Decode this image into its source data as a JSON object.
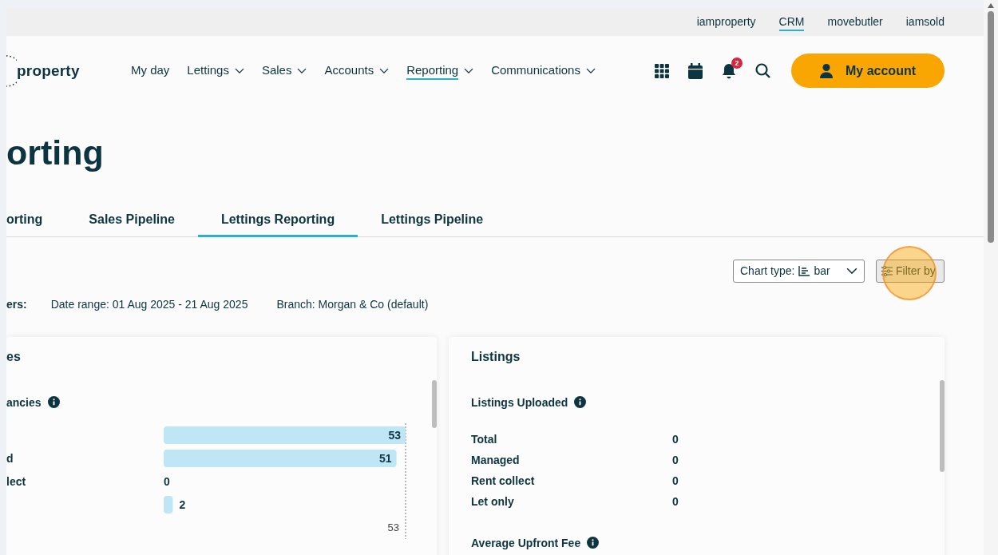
{
  "top_links": [
    {
      "label": "iamproperty",
      "selected": false
    },
    {
      "label": "CRM",
      "selected": true
    },
    {
      "label": "movebutler",
      "selected": false
    },
    {
      "label": "iamsold",
      "selected": false
    }
  ],
  "logo": {
    "text": "property"
  },
  "nav": [
    {
      "label": "My day",
      "dropdown": false,
      "selected": false
    },
    {
      "label": "Lettings",
      "dropdown": true,
      "selected": false
    },
    {
      "label": "Sales",
      "dropdown": true,
      "selected": false
    },
    {
      "label": "Accounts",
      "dropdown": true,
      "selected": false
    },
    {
      "label": "Reporting",
      "dropdown": true,
      "selected": true
    },
    {
      "label": "Communications",
      "dropdown": true,
      "selected": false
    }
  ],
  "notifications": {
    "count": "2"
  },
  "account_button": {
    "label": "My account"
  },
  "page_title": "orting",
  "tabs": [
    {
      "label": "orting",
      "selected": false
    },
    {
      "label": "Sales Pipeline",
      "selected": false
    },
    {
      "label": "Lettings Reporting",
      "selected": true
    },
    {
      "label": "Lettings Pipeline",
      "selected": false
    }
  ],
  "chart_type": {
    "label": "Chart type:",
    "value": "bar"
  },
  "filter_button": {
    "label": "Filter by"
  },
  "filters": {
    "label": "ers:",
    "items": [
      "Date range: 01 Aug 2025 - 21 Aug 2025",
      "Branch: Morgan & Co (default)"
    ]
  },
  "cards": [
    {
      "kind": "chart",
      "title": "es",
      "metric": "ancies",
      "chart_data": {
        "type": "bar",
        "orientation": "horizontal",
        "categories": [
          null,
          "d",
          "lect",
          null
        ],
        "values": [
          53,
          51,
          0,
          2
        ],
        "data_labels": true,
        "annotations": [
          {
            "text": "53"
          }
        ]
      }
    },
    {
      "kind": "table",
      "title": "Listings",
      "metric": "Listings Uploaded",
      "rows": [
        {
          "label": "Total",
          "value": "0"
        },
        {
          "label": "Managed",
          "value": "0"
        },
        {
          "label": "Rent collect",
          "value": "0"
        },
        {
          "label": "Let only",
          "value": "0"
        }
      ],
      "next_metric": "Average Upfront Fee"
    }
  ]
}
